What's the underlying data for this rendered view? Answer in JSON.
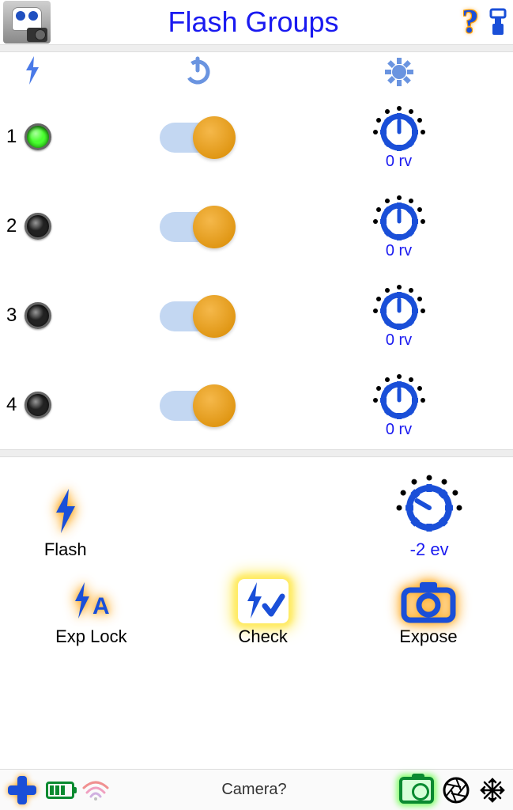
{
  "header": {
    "title": "Flash Groups"
  },
  "groups": [
    {
      "num": "1",
      "active": true,
      "toggle": true,
      "dial": "0 rv"
    },
    {
      "num": "2",
      "active": false,
      "toggle": true,
      "dial": "0 rv"
    },
    {
      "num": "3",
      "active": false,
      "toggle": true,
      "dial": "0 rv"
    },
    {
      "num": "4",
      "active": false,
      "toggle": true,
      "dial": "0 rv"
    }
  ],
  "controls": {
    "flash": "Flash",
    "ev_dial": "-2 ev",
    "exp_lock": "Exp Lock",
    "check": "Check",
    "expose": "Expose"
  },
  "footer": {
    "status": "Camera?"
  }
}
